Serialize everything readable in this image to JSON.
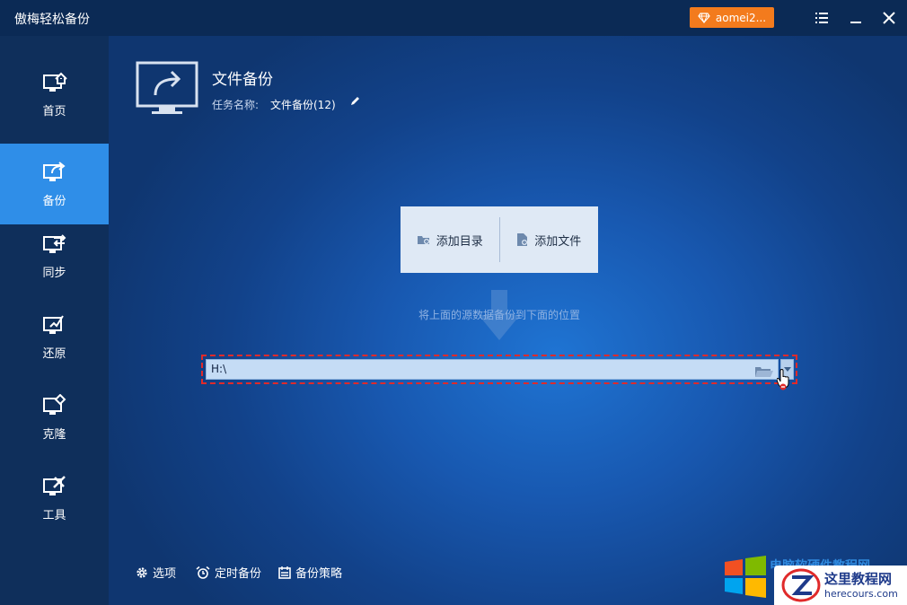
{
  "app": {
    "title": "傲梅轻松备份"
  },
  "account": {
    "name": "aomei2..."
  },
  "sidebar": {
    "items": [
      {
        "label": "首页",
        "icon": "home-icon"
      },
      {
        "label": "备份",
        "icon": "backup-icon",
        "active": true
      },
      {
        "label": "同步",
        "icon": "sync-icon"
      },
      {
        "label": "还原",
        "icon": "restore-icon"
      },
      {
        "label": "克隆",
        "icon": "clone-icon"
      },
      {
        "label": "工具",
        "icon": "tools-icon"
      }
    ]
  },
  "task": {
    "title": "文件备份",
    "name_label": "任务名称:",
    "name_value": "文件备份(12)"
  },
  "source": {
    "add_folder": "添加目录",
    "add_file": "添加文件"
  },
  "hint": "将上面的源数据备份到下面的位置",
  "destination": {
    "path": "H:\\"
  },
  "footer": {
    "options": "选项",
    "schedule": "定时备份",
    "scheme": "备份策略"
  },
  "watermark": {
    "faded_text": "电脑软硬件教程网",
    "site_name": "这里教程网",
    "url": "herecours.com"
  },
  "colors": {
    "accent": "#2f8ee8",
    "badge": "#f37b1d",
    "highlight_border": "#e02a2a"
  }
}
